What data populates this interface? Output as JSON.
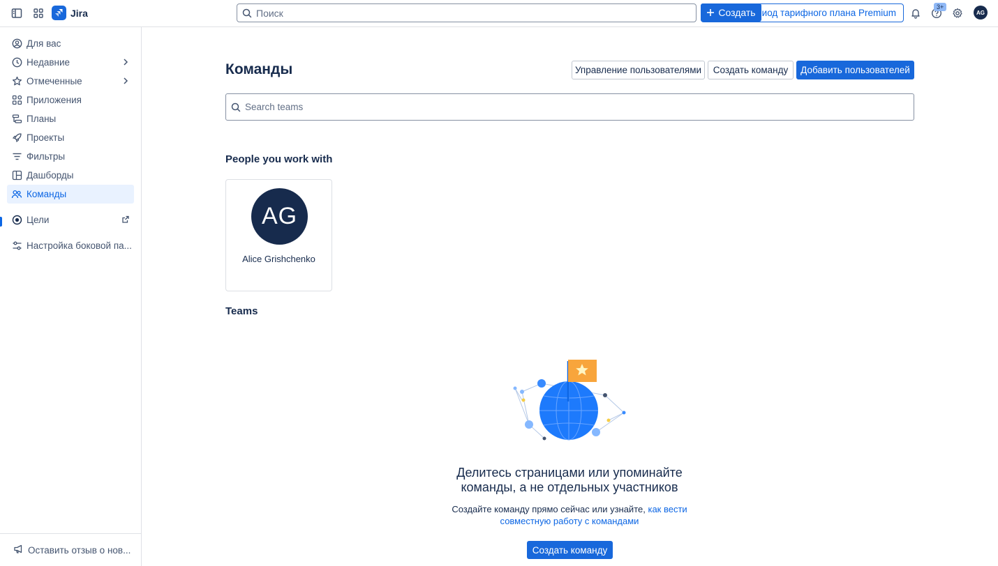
{
  "app": {
    "name": "Jira"
  },
  "topbar": {
    "search_placeholder": "Поиск",
    "create_label": "Создать",
    "premium_label": "ериод тарифного плана Premium",
    "help_badge": "3+",
    "avatar_initials": "AG"
  },
  "sidebar": {
    "items": [
      {
        "label": "Для вас",
        "icon": "user-circle-icon"
      },
      {
        "label": "Недавние",
        "icon": "clock-icon"
      },
      {
        "label": "Отмеченные",
        "icon": "star-icon"
      },
      {
        "label": "Приложения",
        "icon": "apps-icon"
      },
      {
        "label": "Планы",
        "icon": "plans-icon"
      },
      {
        "label": "Проекты",
        "icon": "rocket-icon"
      },
      {
        "label": "Фильтры",
        "icon": "filter-icon"
      },
      {
        "label": "Дашборды",
        "icon": "dashboard-icon"
      },
      {
        "label": "Команды",
        "icon": "people-icon"
      },
      {
        "label": "Цели",
        "icon": "goal-icon"
      },
      {
        "label": "Настройка боковой па...",
        "icon": "customize-icon"
      }
    ],
    "feedback_label": "Оставить отзыв о нов..."
  },
  "main": {
    "title": "Команды",
    "manage_users_label": "Управление пользователями",
    "create_team_label": "Создать команду",
    "add_users_label": "Добавить пользователей",
    "search_placeholder": "Search teams",
    "people_title": "People you work with",
    "people": [
      {
        "initials": "AG",
        "name": "Alice Grishchenko"
      }
    ],
    "teams_title": "Teams",
    "empty": {
      "title": "Делитесь страницами или упоминайте команды, а не отдельных участников",
      "desc_prefix": "Создайте команду прямо сейчас или узнайте, ",
      "desc_link": "как вести совместную работу с командами",
      "button_label": "Создать команду"
    }
  },
  "colors": {
    "brand": "#1868db",
    "link": "#0c66e4",
    "text": "#172b4d",
    "active_bg": "#e9f2ff"
  }
}
